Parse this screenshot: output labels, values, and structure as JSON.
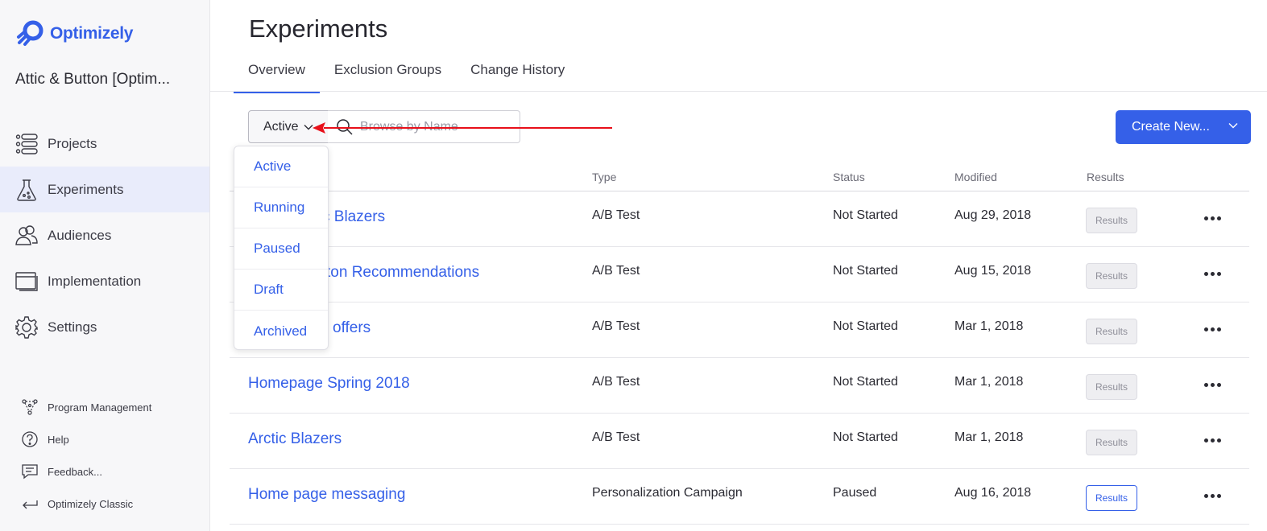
{
  "brand": {
    "name": "Optimizely",
    "color": "#3560e8"
  },
  "account": {
    "name": "Attic & Button [Optim..."
  },
  "sidebar": {
    "items": [
      {
        "label": "Projects",
        "icon": "projects-icon"
      },
      {
        "label": "Experiments",
        "icon": "flask-icon",
        "active": true
      },
      {
        "label": "Audiences",
        "icon": "audiences-icon"
      },
      {
        "label": "Implementation",
        "icon": "implementation-icon"
      },
      {
        "label": "Settings",
        "icon": "gear-icon"
      }
    ],
    "bottom": [
      {
        "label": "Program Management",
        "icon": "program-management-icon"
      },
      {
        "label": "Help",
        "icon": "help-icon"
      },
      {
        "label": "Feedback...",
        "icon": "feedback-icon"
      },
      {
        "label": "Optimizely Classic",
        "icon": "return-arrow-icon"
      }
    ]
  },
  "page": {
    "title": "Experiments",
    "tabs": [
      {
        "label": "Overview",
        "active": true
      },
      {
        "label": "Exclusion Groups"
      },
      {
        "label": "Change History"
      }
    ]
  },
  "filter": {
    "selected": "Active",
    "options": [
      "Active",
      "Running",
      "Paused",
      "Draft",
      "Archived"
    ]
  },
  "search": {
    "placeholder": "Browse by Name",
    "value": ""
  },
  "create_button": {
    "label": "Create New..."
  },
  "table": {
    "columns": [
      "Type",
      "Status",
      "Modified",
      "Results"
    ],
    "rows": [
      {
        "name": "ctic Blazers",
        "type": "A/B Test",
        "status": "Not Started",
        "modified": "Aug 29, 2018",
        "results": "Results",
        "results_enabled": false
      },
      {
        "name": "ton Recommendations",
        "type": "A/B Test",
        "status": "Not Started",
        "modified": "Aug 15, 2018",
        "results": "Results",
        "results_enabled": false
      },
      {
        "name": "offers",
        "type": "A/B Test",
        "status": "Not Started",
        "modified": "Mar 1, 2018",
        "results": "Results",
        "results_enabled": false
      },
      {
        "name": "Homepage Spring 2018",
        "type": "A/B Test",
        "status": "Not Started",
        "modified": "Mar 1, 2018",
        "results": "Results",
        "results_enabled": false
      },
      {
        "name": "Arctic Blazers",
        "type": "A/B Test",
        "status": "Not Started",
        "modified": "Mar 1, 2018",
        "results": "Results",
        "results_enabled": false
      },
      {
        "name": "Home page messaging",
        "type": "Personalization Campaign",
        "status": "Paused",
        "modified": "Aug 16, 2018",
        "results": "Results",
        "results_enabled": true
      }
    ]
  },
  "annotation": {
    "color": "#e8101a"
  }
}
